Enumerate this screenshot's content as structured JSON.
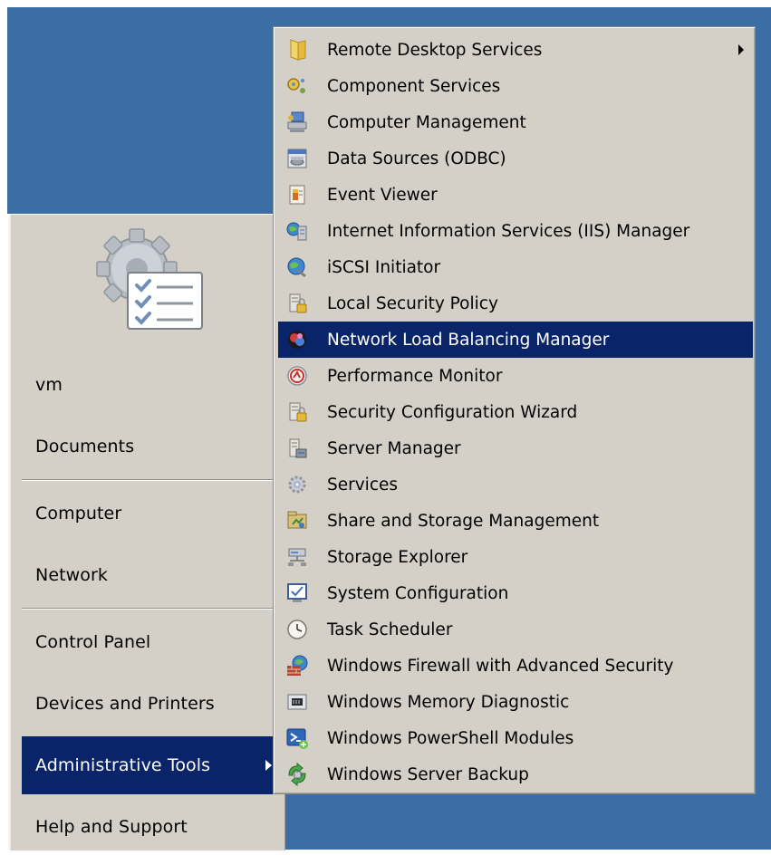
{
  "start_menu": {
    "items": [
      {
        "label": "vm"
      },
      {
        "label": "Documents"
      },
      {
        "label": "Computer"
      },
      {
        "label": "Network"
      },
      {
        "label": "Control Panel"
      },
      {
        "label": "Devices and Printers"
      },
      {
        "label": "Administrative Tools",
        "selected": true,
        "has_submenu": true
      },
      {
        "label": "Help and Support"
      }
    ],
    "pane_icon": "administrative-tools-icon"
  },
  "admin_tools_menu": {
    "highlight_color": "#0a246a",
    "items": [
      {
        "label": "Remote Desktop Services",
        "icon": "folder-icon",
        "has_submenu": true
      },
      {
        "label": "Component Services",
        "icon": "component-services-icon"
      },
      {
        "label": "Computer Management",
        "icon": "computer-management-icon"
      },
      {
        "label": "Data Sources (ODBC)",
        "icon": "odbc-data-sources-icon"
      },
      {
        "label": "Event Viewer",
        "icon": "event-viewer-icon"
      },
      {
        "label": "Internet Information Services (IIS) Manager",
        "icon": "iis-manager-icon"
      },
      {
        "label": "iSCSI Initiator",
        "icon": "iscsi-initiator-icon"
      },
      {
        "label": "Local Security Policy",
        "icon": "local-security-policy-icon"
      },
      {
        "label": "Network Load Balancing Manager",
        "icon": "network-load-balancing-icon",
        "highlighted": true
      },
      {
        "label": "Performance Monitor",
        "icon": "performance-monitor-icon"
      },
      {
        "label": "Security Configuration Wizard",
        "icon": "security-configuration-wizard-icon"
      },
      {
        "label": "Server Manager",
        "icon": "server-manager-icon"
      },
      {
        "label": "Services",
        "icon": "services-gear-icon"
      },
      {
        "label": "Share and Storage Management",
        "icon": "share-storage-management-icon"
      },
      {
        "label": "Storage Explorer",
        "icon": "storage-explorer-icon"
      },
      {
        "label": "System Configuration",
        "icon": "system-configuration-icon"
      },
      {
        "label": "Task Scheduler",
        "icon": "task-scheduler-clock-icon"
      },
      {
        "label": "Windows Firewall with Advanced Security",
        "icon": "firewall-icon"
      },
      {
        "label": "Windows Memory Diagnostic",
        "icon": "memory-diagnostic-icon"
      },
      {
        "label": "Windows PowerShell Modules",
        "icon": "powershell-icon"
      },
      {
        "label": "Windows Server Backup",
        "icon": "server-backup-icon"
      }
    ]
  }
}
